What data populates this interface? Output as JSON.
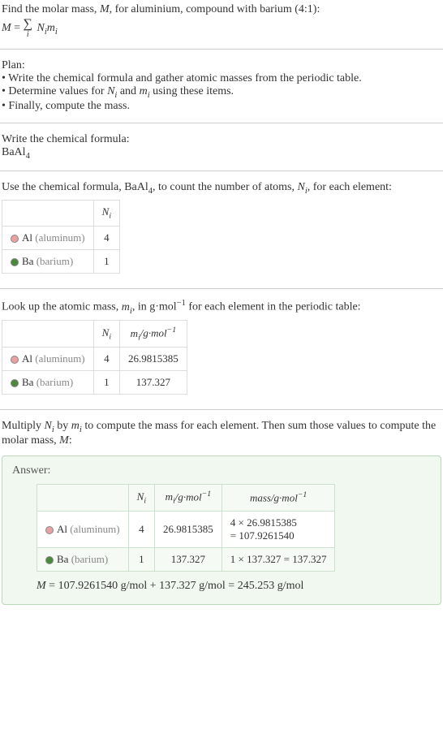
{
  "intro": {
    "line1_prefix": "Find the molar mass, ",
    "line1_var": "M",
    "line1_mid": ", for aluminium, compound with barium (4:1):",
    "formula_lhs": "M",
    "formula_eq": " = ",
    "sum_sigma": "∑",
    "sum_idx": "i",
    "formula_rhs": "Nᵢmᵢ"
  },
  "plan": {
    "heading": "Plan:",
    "b1": "• Write the chemical formula and gather atomic masses from the periodic table.",
    "b2_a": "• Determine values for ",
    "b2_n": "Nᵢ",
    "b2_b": " and ",
    "b2_m": "mᵢ",
    "b2_c": " using these items.",
    "b3": "• Finally, compute the mass."
  },
  "chem": {
    "heading": "Write the chemical formula:",
    "formula_base": "BaAl",
    "formula_sub": "4"
  },
  "count": {
    "text_a": "Use the chemical formula, ",
    "text_formula_base": "BaAl",
    "text_formula_sub": "4",
    "text_b": ", to count the number of atoms, ",
    "text_var": "Nᵢ",
    "text_c": ", for each element:",
    "col_n": "Nᵢ",
    "rows": [
      {
        "el_sym": "Al",
        "el_name": "(aluminum)",
        "n": "4"
      },
      {
        "el_sym": "Ba",
        "el_name": "(barium)",
        "n": "1"
      }
    ]
  },
  "lookup": {
    "text_a": "Look up the atomic mass, ",
    "text_var": "mᵢ",
    "text_b": ", in g·mol",
    "text_exp": "−1",
    "text_c": " for each element in the periodic table:",
    "col_n": "Nᵢ",
    "col_m_a": "mᵢ",
    "col_m_b": "/g·mol",
    "col_m_exp": "−1",
    "rows": [
      {
        "el_sym": "Al",
        "el_name": "(aluminum)",
        "n": "4",
        "m": "26.9815385"
      },
      {
        "el_sym": "Ba",
        "el_name": "(barium)",
        "n": "1",
        "m": "137.327"
      }
    ]
  },
  "multiply": {
    "text_a": "Multiply ",
    "text_n": "Nᵢ",
    "text_b": " by ",
    "text_m": "mᵢ",
    "text_c": " to compute the mass for each element. Then sum those values to compute the molar mass, ",
    "text_M": "M",
    "text_d": ":"
  },
  "answer": {
    "label": "Answer:",
    "col_n": "Nᵢ",
    "col_m_a": "mᵢ",
    "col_m_b": "/g·mol",
    "col_m_exp": "−1",
    "col_mass_a": "mass/g·mol",
    "col_mass_exp": "−1",
    "rows": [
      {
        "el_sym": "Al",
        "el_name": "(aluminum)",
        "n": "4",
        "m": "26.9815385",
        "mass_a": "4 × 26.9815385",
        "mass_b": "= 107.9261540"
      },
      {
        "el_sym": "Ba",
        "el_name": "(barium)",
        "n": "1",
        "m": "137.327",
        "mass_a": "1 × 137.327 = 137.327",
        "mass_b": ""
      }
    ],
    "result_lhs": "M",
    "result_rest": " = 107.9261540 g/mol + 137.327 g/mol = 245.253 g/mol"
  }
}
